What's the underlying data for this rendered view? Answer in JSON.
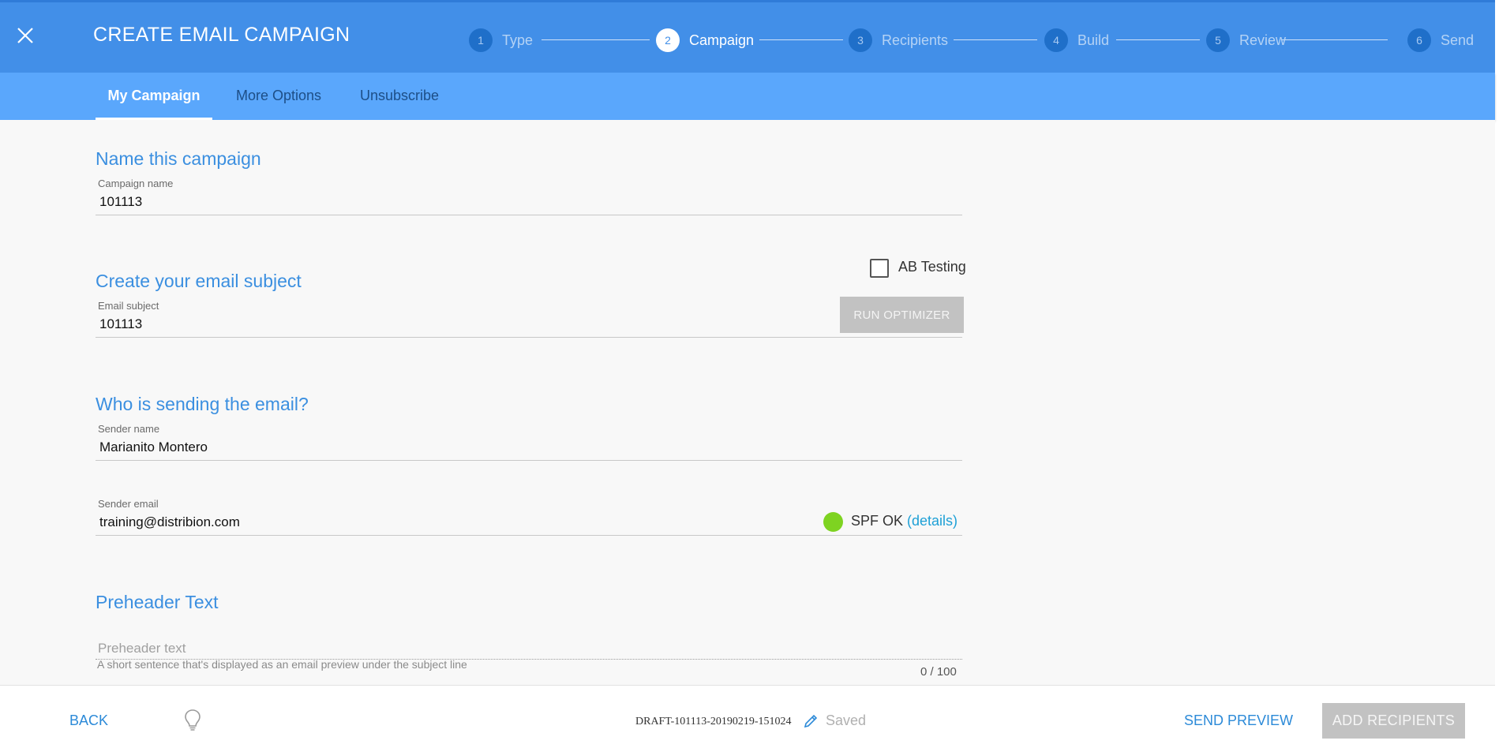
{
  "header": {
    "title": "CREATE EMAIL CAMPAIGN",
    "steps": [
      {
        "number": "1",
        "label": "Type"
      },
      {
        "number": "2",
        "label": "Campaign"
      },
      {
        "number": "3",
        "label": "Recipients"
      },
      {
        "number": "4",
        "label": "Build"
      },
      {
        "number": "5",
        "label": "Review"
      },
      {
        "number": "6",
        "label": "Send"
      }
    ],
    "active_step": "Campaign"
  },
  "tabs": [
    {
      "label": "My Campaign"
    },
    {
      "label": "More Options"
    },
    {
      "label": "Unsubscribe"
    }
  ],
  "active_tab": "My Campaign",
  "form": {
    "name_section": {
      "title": "Name this campaign",
      "label": "Campaign name",
      "value": "101113"
    },
    "subject_section": {
      "title": "Create your email subject",
      "ab_testing_label": "AB Testing",
      "ab_testing_checked": false,
      "label": "Email subject",
      "value": "101113",
      "run_optimizer_label": "RUN OPTIMIZER"
    },
    "sender_section": {
      "title": "Who is sending the email?",
      "name_label": "Sender name",
      "name_value": "Marianito Montero",
      "email_label": "Sender email",
      "email_value": "training@distribion.com",
      "spf_status": "SPF OK",
      "spf_details": "(details)",
      "spf_color": "#7ed321"
    },
    "preheader_section": {
      "title": "Preheader Text",
      "placeholder": "Preheader text",
      "value": "",
      "help": "A short sentence that's displayed as an email preview under the subject line",
      "counter": "0 / 100"
    }
  },
  "footer": {
    "back_label": "BACK",
    "draft_name": "DRAFT-101113-20190219-151024",
    "saved_label": "Saved",
    "send_preview_label": "SEND PREVIEW",
    "add_recipients_label": "ADD RECIPIENTS"
  },
  "colors": {
    "header_bg": "#428fe8",
    "tabbar_bg": "#5aa7fc",
    "accent": "#3b8fe0",
    "link": "#2c8ad8"
  }
}
